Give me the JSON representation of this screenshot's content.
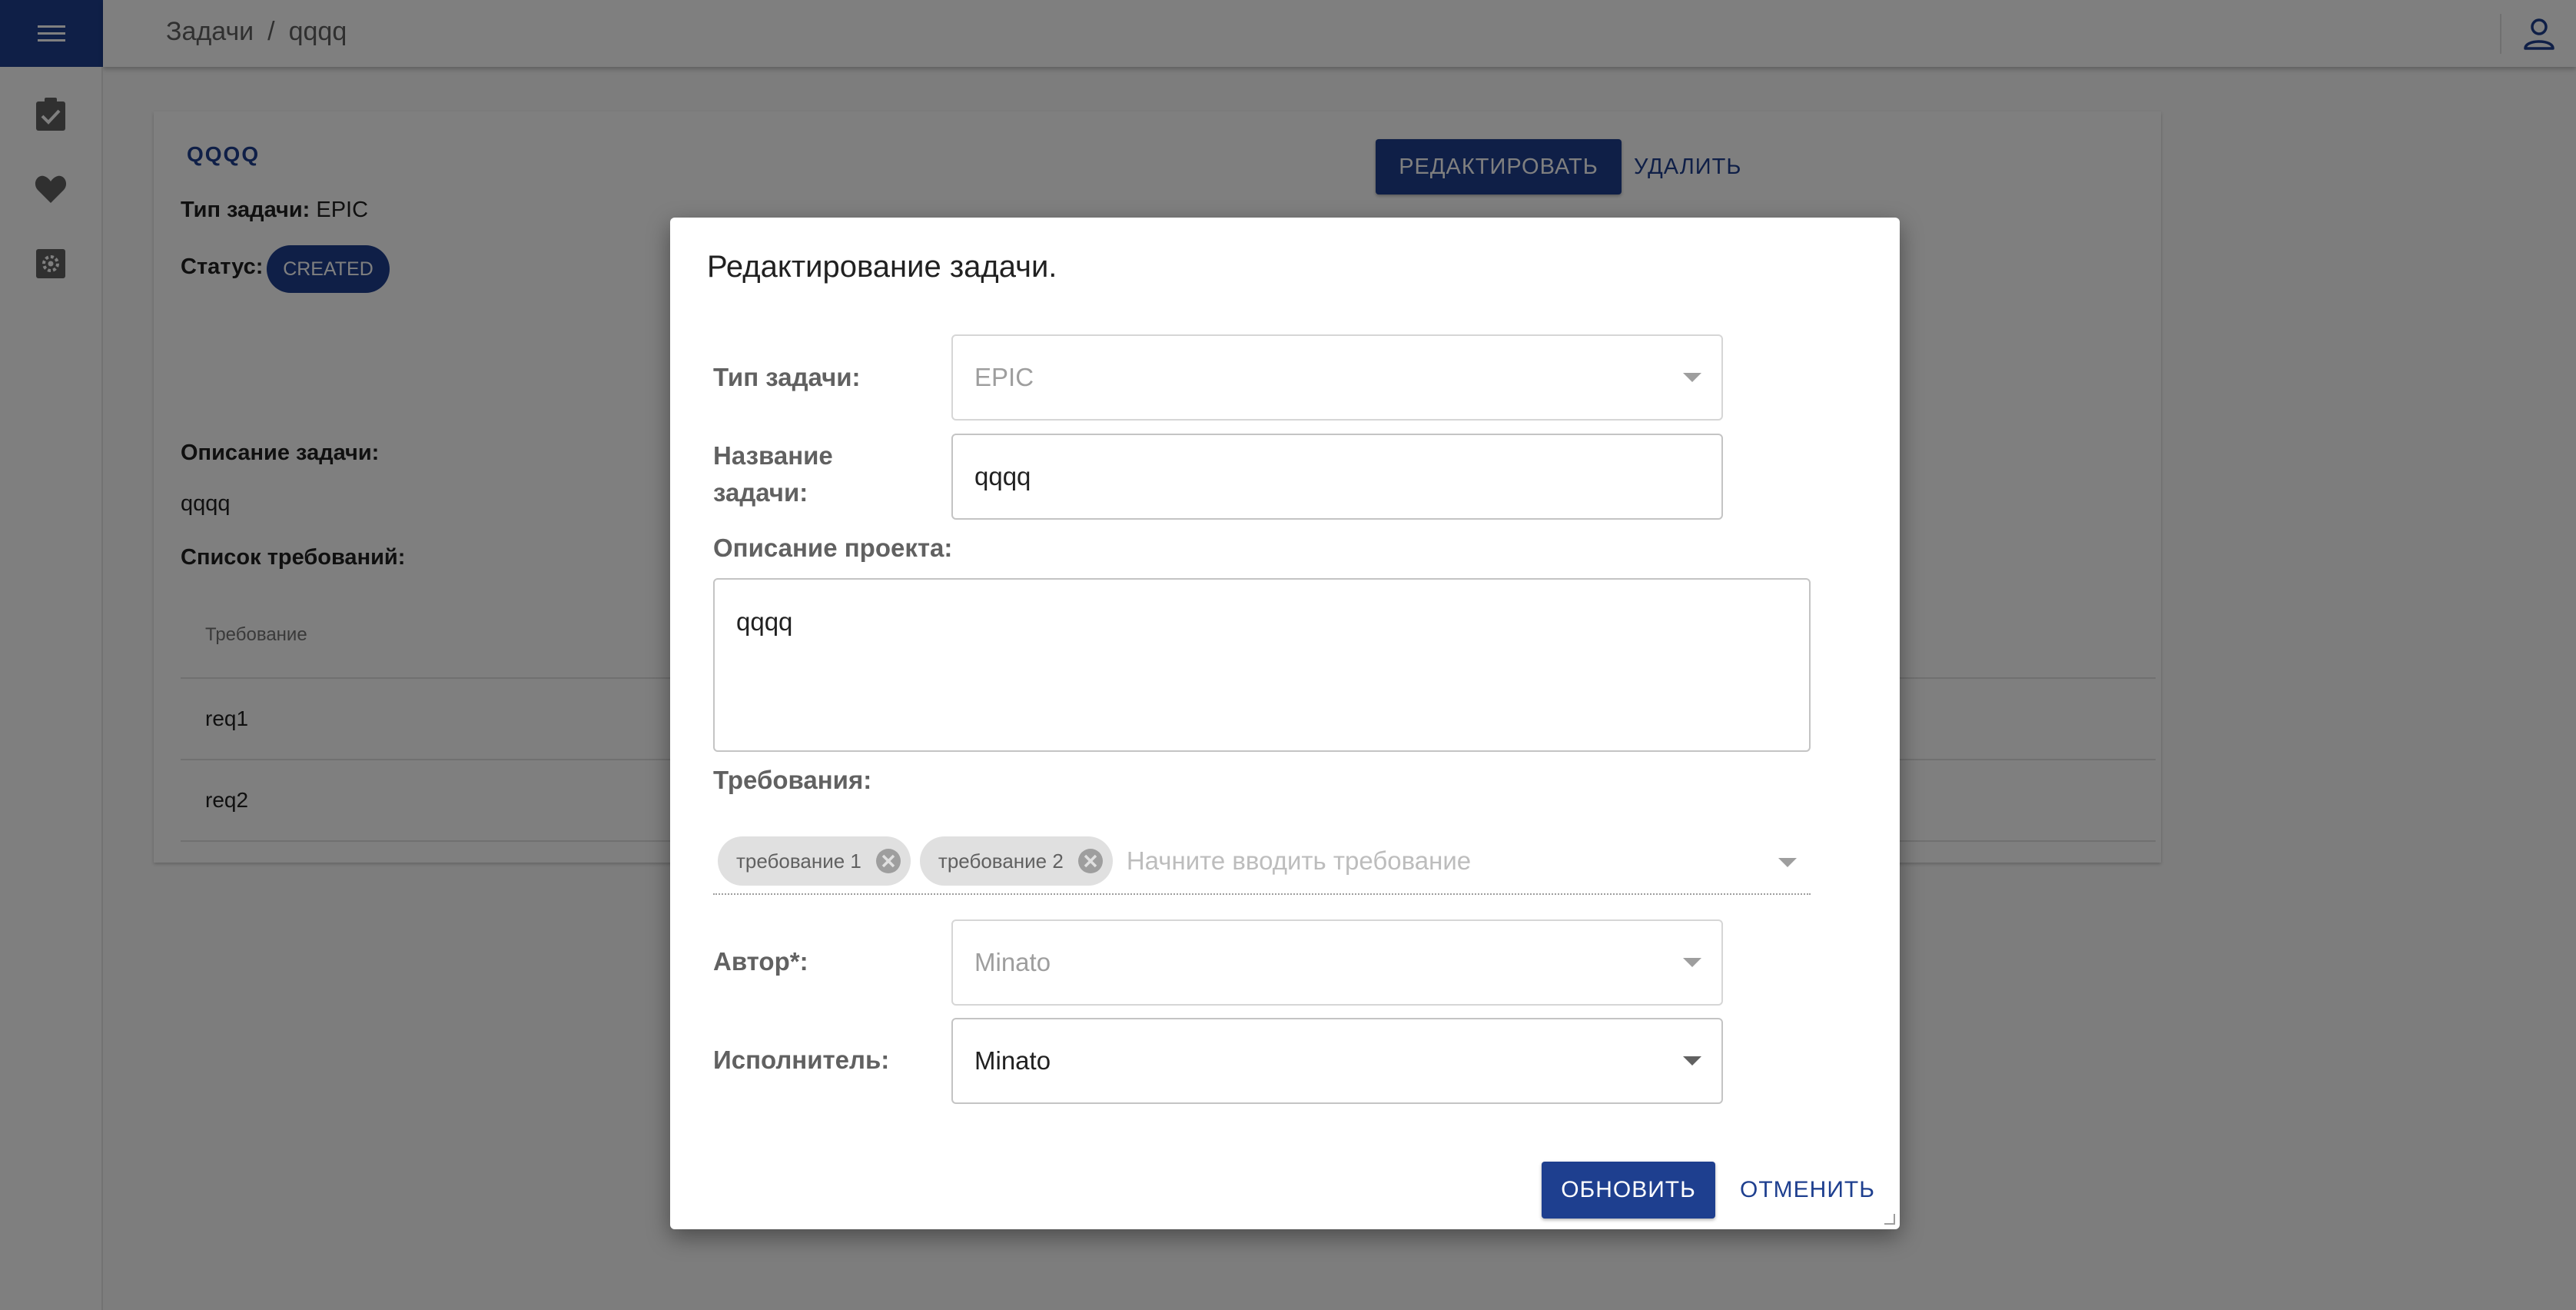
{
  "breadcrumb": {
    "root": "Задачи",
    "separator": "/",
    "current": "qqqq"
  },
  "sidebar": {
    "items": [
      {
        "icon": "task-check-icon"
      },
      {
        "icon": "heart-icon"
      },
      {
        "icon": "settings-icon"
      }
    ]
  },
  "task": {
    "title": "QQQQ",
    "type_label": "Тип задачи:",
    "type_value": "EPIC",
    "status_label": "Статус:",
    "status_value": "CREATED",
    "edit_button": "РЕДАКТИРОВАТЬ",
    "delete_button": "УДАЛИТЬ",
    "description_label": "Описание задачи:",
    "description_value": "qqqq",
    "requirements_label": "Список требований:",
    "requirements_header": "Требование",
    "requirements": [
      "req1",
      "req2"
    ]
  },
  "dialog": {
    "title": "Редактирование задачи.",
    "type_label": "Тип задачи:",
    "type_value": "EPIC",
    "name_label_1": "Название",
    "name_label_2": "задачи:",
    "name_value": "qqqq",
    "description_label": "Описание проекта:",
    "description_value": "qqqq",
    "requirements_label": "Требования:",
    "requirement_chips": [
      "требование 1",
      "требование 2"
    ],
    "requirements_placeholder": "Начните вводить требование",
    "author_label": "Автор*:",
    "author_value": "Minato",
    "assignee_label": "Исполнитель:",
    "assignee_value": "Minato",
    "update_button": "ОБНОВИТЬ",
    "cancel_button": "ОТМЕНИТЬ"
  },
  "colors": {
    "primary": "#1e3f8f",
    "overlay": "rgba(0,0,0,0.5)"
  }
}
